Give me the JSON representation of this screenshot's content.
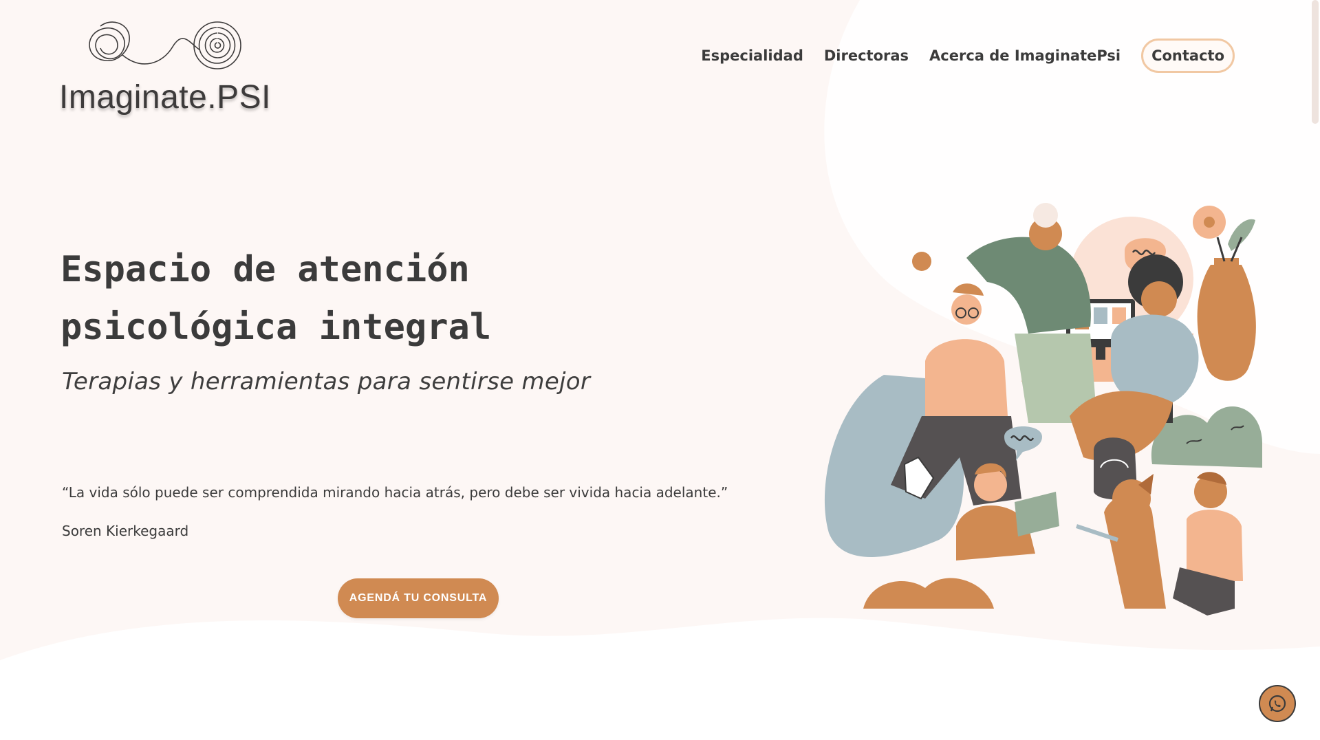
{
  "header": {
    "logo_text": "Imaginate.PSI",
    "nav": [
      {
        "label": "Especialidad"
      },
      {
        "label": "Directoras"
      },
      {
        "label": "Acerca de ImaginatePsi"
      },
      {
        "label": "Contacto"
      }
    ]
  },
  "hero": {
    "title_line1": "Espacio de atención",
    "title_line2": "psicológica integral",
    "subtitle": "Terapias y herramientas para sentirse mejor",
    "quote": "“La vida sólo puede ser comprendida mirando hacia atrás, pero debe ser vivida hacia adelante.”",
    "quote_author": "Soren Kierkegaard",
    "cta_label": "AGENDÁ TU CONSULTA"
  },
  "icons": {
    "logo": "scribble-spiral-logo-icon",
    "whatsapp": "whatsapp-icon",
    "illustration": "people-group-illustration"
  },
  "colors": {
    "accent": "#d08a52",
    "contact_border": "#f1c8a3",
    "text": "#3b3b3b",
    "background": "#fdf7f5"
  }
}
